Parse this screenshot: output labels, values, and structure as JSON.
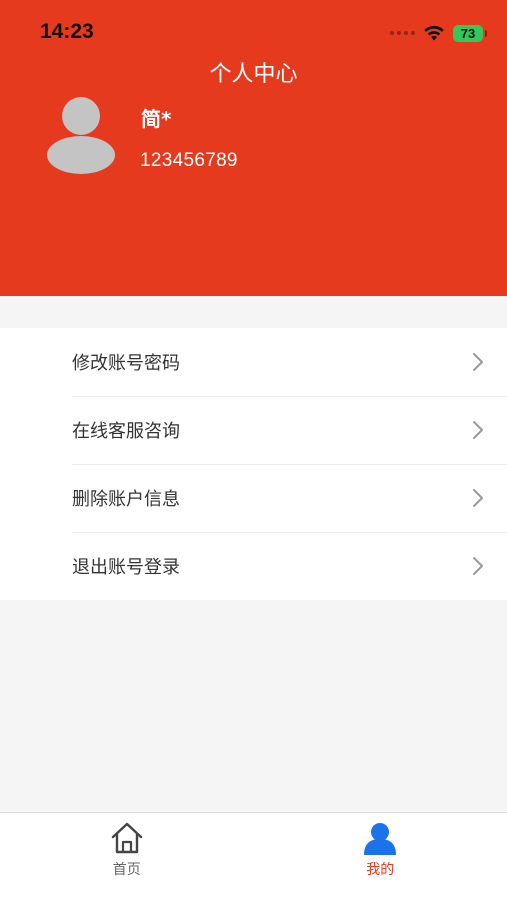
{
  "status_bar": {
    "time": "14:23",
    "battery": "73"
  },
  "header": {
    "title": "个人中心",
    "user_name": "简*",
    "user_phone": "123456789"
  },
  "menu": {
    "items": [
      {
        "label": "修改账号密码"
      },
      {
        "label": "在线客服咨询"
      },
      {
        "label": "删除账户信息"
      },
      {
        "label": "退出账号登录"
      }
    ]
  },
  "tabbar": {
    "tabs": [
      {
        "label": "首页",
        "icon": "home-icon"
      },
      {
        "label": "我的",
        "icon": "user-icon",
        "active": true
      }
    ]
  },
  "colors": {
    "brand": "#e63a1f",
    "tab_active_icon": "#1a73e8"
  }
}
